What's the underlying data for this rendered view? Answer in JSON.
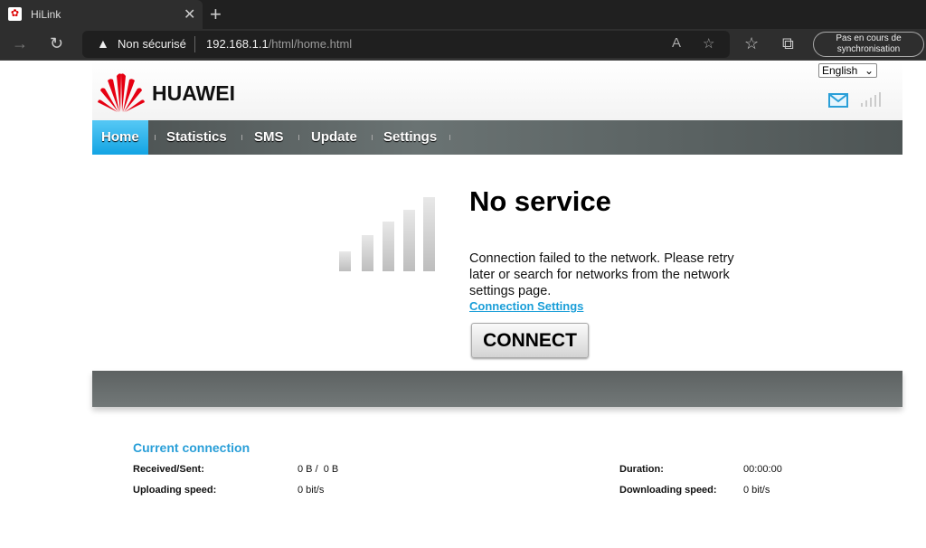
{
  "browser": {
    "tab_title": "HiLink",
    "security": "Non sécurisé",
    "url_host": "192.168.1.1",
    "url_path": "/html/home.html",
    "sync": "Pas en cours de synchronisation"
  },
  "header": {
    "brand": "HUAWEI",
    "language": "English",
    "brand_color": "#e60012"
  },
  "nav": {
    "items": [
      {
        "label": "Home",
        "active": true
      },
      {
        "label": "Statistics"
      },
      {
        "label": "SMS"
      },
      {
        "label": "Update"
      },
      {
        "label": "Settings"
      }
    ]
  },
  "main": {
    "status": "No service",
    "signal_bars": 0,
    "message": "Connection failed to the network. Please retry later or search for networks from the network settings page.",
    "link": "Connection Settings",
    "connect": "CONNECT"
  },
  "connection": {
    "title": "Current connection",
    "received_sent_label": "Received/Sent:",
    "received_sent": "0 B /  0 B",
    "upload_label": "Uploading speed:",
    "upload": "0 bit/s",
    "duration_label": "Duration:",
    "duration": "00:00:00",
    "download_label": "Downloading speed:",
    "download": "0 bit/s"
  },
  "accent": "#1a9ed8"
}
